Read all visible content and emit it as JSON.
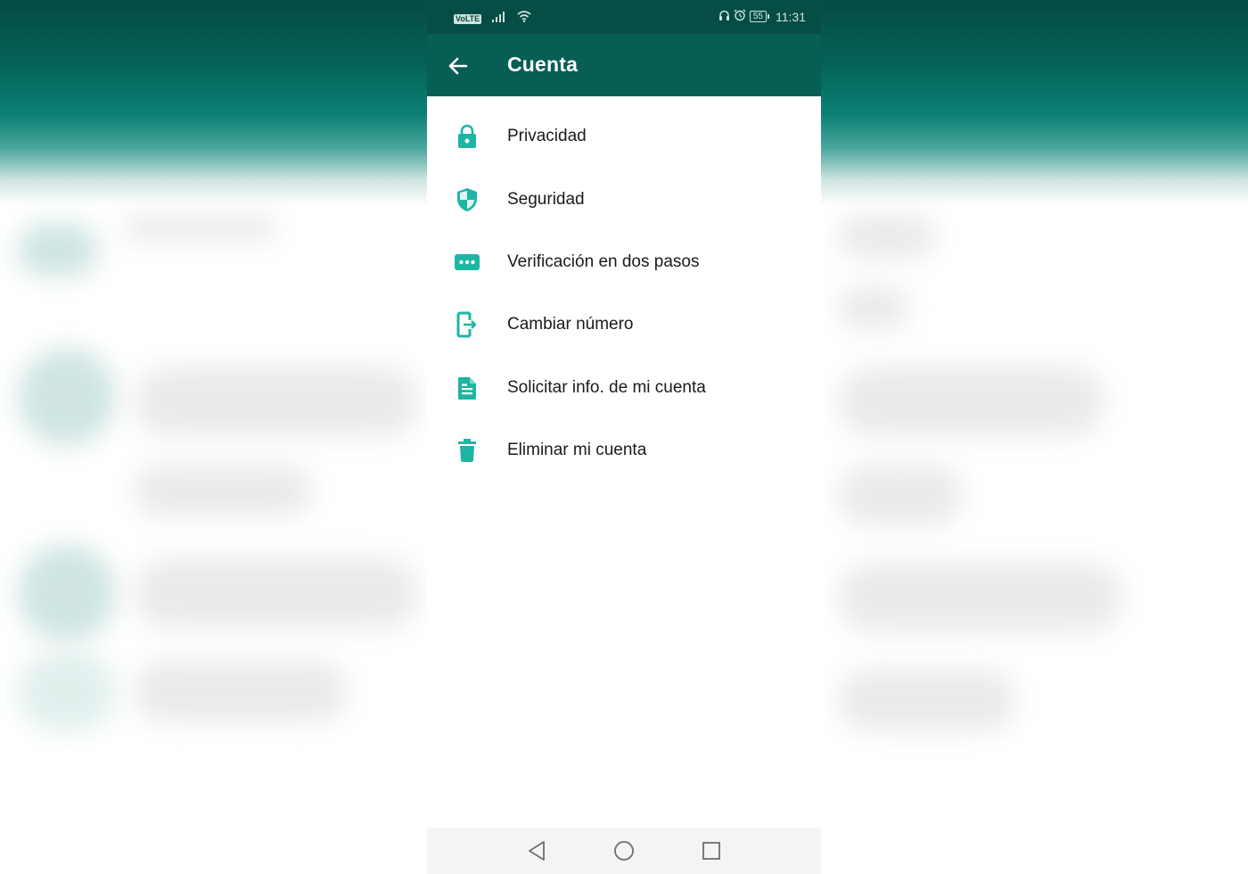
{
  "status_bar": {
    "carrier_badge": "VoLTE",
    "battery_level": "55",
    "time": "11:31",
    "icons": [
      "volte-icon",
      "signal-icon",
      "wifi-icon",
      "headset-icon",
      "alarm-icon",
      "battery-icon"
    ]
  },
  "app_bar": {
    "title": "Cuenta",
    "back_icon": "arrow-back-icon"
  },
  "menu": {
    "items": [
      {
        "label": "Privacidad",
        "icon": "lock-icon"
      },
      {
        "label": "Seguridad",
        "icon": "shield-icon"
      },
      {
        "label": "Verificación en dos pasos",
        "icon": "dots-icon"
      },
      {
        "label": "Cambiar número",
        "icon": "change-number-icon"
      },
      {
        "label": "Solicitar info. de mi cuenta",
        "icon": "document-icon"
      },
      {
        "label": "Eliminar mi cuenta",
        "icon": "trash-icon"
      }
    ]
  },
  "nav_bar": {
    "buttons": [
      "back-triangle-icon",
      "home-circle-icon",
      "recents-square-icon"
    ]
  },
  "colors": {
    "status_bar": "#054d45",
    "app_bar": "#075e54",
    "icon_accent": "#1fb5a4",
    "text": "#1b1b1b"
  }
}
